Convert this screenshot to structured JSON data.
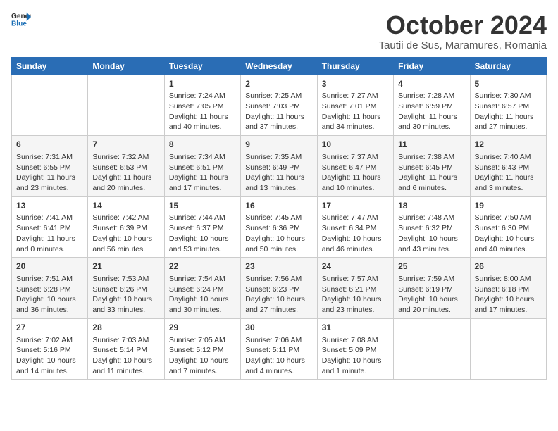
{
  "header": {
    "logo_general": "General",
    "logo_blue": "Blue",
    "month_title": "October 2024",
    "location": "Tautii de Sus, Maramures, Romania"
  },
  "weekdays": [
    "Sunday",
    "Monday",
    "Tuesday",
    "Wednesday",
    "Thursday",
    "Friday",
    "Saturday"
  ],
  "weeks": [
    [
      {
        "day": "",
        "info": ""
      },
      {
        "day": "",
        "info": ""
      },
      {
        "day": "1",
        "info": "Sunrise: 7:24 AM\nSunset: 7:05 PM\nDaylight: 11 hours and 40 minutes."
      },
      {
        "day": "2",
        "info": "Sunrise: 7:25 AM\nSunset: 7:03 PM\nDaylight: 11 hours and 37 minutes."
      },
      {
        "day": "3",
        "info": "Sunrise: 7:27 AM\nSunset: 7:01 PM\nDaylight: 11 hours and 34 minutes."
      },
      {
        "day": "4",
        "info": "Sunrise: 7:28 AM\nSunset: 6:59 PM\nDaylight: 11 hours and 30 minutes."
      },
      {
        "day": "5",
        "info": "Sunrise: 7:30 AM\nSunset: 6:57 PM\nDaylight: 11 hours and 27 minutes."
      }
    ],
    [
      {
        "day": "6",
        "info": "Sunrise: 7:31 AM\nSunset: 6:55 PM\nDaylight: 11 hours and 23 minutes."
      },
      {
        "day": "7",
        "info": "Sunrise: 7:32 AM\nSunset: 6:53 PM\nDaylight: 11 hours and 20 minutes."
      },
      {
        "day": "8",
        "info": "Sunrise: 7:34 AM\nSunset: 6:51 PM\nDaylight: 11 hours and 17 minutes."
      },
      {
        "day": "9",
        "info": "Sunrise: 7:35 AM\nSunset: 6:49 PM\nDaylight: 11 hours and 13 minutes."
      },
      {
        "day": "10",
        "info": "Sunrise: 7:37 AM\nSunset: 6:47 PM\nDaylight: 11 hours and 10 minutes."
      },
      {
        "day": "11",
        "info": "Sunrise: 7:38 AM\nSunset: 6:45 PM\nDaylight: 11 hours and 6 minutes."
      },
      {
        "day": "12",
        "info": "Sunrise: 7:40 AM\nSunset: 6:43 PM\nDaylight: 11 hours and 3 minutes."
      }
    ],
    [
      {
        "day": "13",
        "info": "Sunrise: 7:41 AM\nSunset: 6:41 PM\nDaylight: 11 hours and 0 minutes."
      },
      {
        "day": "14",
        "info": "Sunrise: 7:42 AM\nSunset: 6:39 PM\nDaylight: 10 hours and 56 minutes."
      },
      {
        "day": "15",
        "info": "Sunrise: 7:44 AM\nSunset: 6:37 PM\nDaylight: 10 hours and 53 minutes."
      },
      {
        "day": "16",
        "info": "Sunrise: 7:45 AM\nSunset: 6:36 PM\nDaylight: 10 hours and 50 minutes."
      },
      {
        "day": "17",
        "info": "Sunrise: 7:47 AM\nSunset: 6:34 PM\nDaylight: 10 hours and 46 minutes."
      },
      {
        "day": "18",
        "info": "Sunrise: 7:48 AM\nSunset: 6:32 PM\nDaylight: 10 hours and 43 minutes."
      },
      {
        "day": "19",
        "info": "Sunrise: 7:50 AM\nSunset: 6:30 PM\nDaylight: 10 hours and 40 minutes."
      }
    ],
    [
      {
        "day": "20",
        "info": "Sunrise: 7:51 AM\nSunset: 6:28 PM\nDaylight: 10 hours and 36 minutes."
      },
      {
        "day": "21",
        "info": "Sunrise: 7:53 AM\nSunset: 6:26 PM\nDaylight: 10 hours and 33 minutes."
      },
      {
        "day": "22",
        "info": "Sunrise: 7:54 AM\nSunset: 6:24 PM\nDaylight: 10 hours and 30 minutes."
      },
      {
        "day": "23",
        "info": "Sunrise: 7:56 AM\nSunset: 6:23 PM\nDaylight: 10 hours and 27 minutes."
      },
      {
        "day": "24",
        "info": "Sunrise: 7:57 AM\nSunset: 6:21 PM\nDaylight: 10 hours and 23 minutes."
      },
      {
        "day": "25",
        "info": "Sunrise: 7:59 AM\nSunset: 6:19 PM\nDaylight: 10 hours and 20 minutes."
      },
      {
        "day": "26",
        "info": "Sunrise: 8:00 AM\nSunset: 6:18 PM\nDaylight: 10 hours and 17 minutes."
      }
    ],
    [
      {
        "day": "27",
        "info": "Sunrise: 7:02 AM\nSunset: 5:16 PM\nDaylight: 10 hours and 14 minutes."
      },
      {
        "day": "28",
        "info": "Sunrise: 7:03 AM\nSunset: 5:14 PM\nDaylight: 10 hours and 11 minutes."
      },
      {
        "day": "29",
        "info": "Sunrise: 7:05 AM\nSunset: 5:12 PM\nDaylight: 10 hours and 7 minutes."
      },
      {
        "day": "30",
        "info": "Sunrise: 7:06 AM\nSunset: 5:11 PM\nDaylight: 10 hours and 4 minutes."
      },
      {
        "day": "31",
        "info": "Sunrise: 7:08 AM\nSunset: 5:09 PM\nDaylight: 10 hours and 1 minute."
      },
      {
        "day": "",
        "info": ""
      },
      {
        "day": "",
        "info": ""
      }
    ]
  ]
}
